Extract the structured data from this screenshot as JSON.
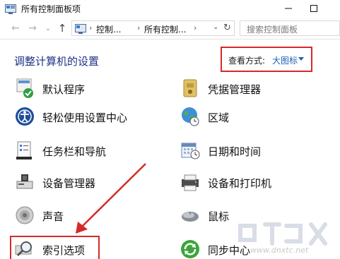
{
  "window": {
    "title": "所有控制面板项",
    "minimize_glyph": "—",
    "maximize_glyph": "☐"
  },
  "navigation": {
    "back_glyph": "←",
    "forward_glyph": "→",
    "recent_glyph": "⌄",
    "up_glyph": "↑",
    "breadcrumbs": [
      "控制...",
      "所有控制..."
    ],
    "separator": "›",
    "dropdown_glyph": "⌄",
    "refresh_glyph": "↻"
  },
  "search": {
    "placeholder": "搜索控制面板"
  },
  "header": {
    "heading": "调整计算机的设置",
    "view_by_label": "查看方式:",
    "view_by_value": "大图标"
  },
  "items": [
    {
      "label": "默认程序",
      "icon": "default-programs-icon"
    },
    {
      "label": "凭据管理器",
      "icon": "credential-manager-icon"
    },
    {
      "label": "轻松使用设置中心",
      "icon": "ease-of-access-icon"
    },
    {
      "label": "区域",
      "icon": "region-icon"
    },
    {
      "label": "任务栏和导航",
      "icon": "taskbar-icon"
    },
    {
      "label": "日期和时间",
      "icon": "date-time-icon"
    },
    {
      "label": "设备管理器",
      "icon": "device-manager-icon"
    },
    {
      "label": "设备和打印机",
      "icon": "devices-printers-icon"
    },
    {
      "label": "声音",
      "icon": "sound-icon"
    },
    {
      "label": "鼠标",
      "icon": "mouse-icon"
    },
    {
      "label": "索引选项",
      "icon": "indexing-options-icon"
    },
    {
      "label": "同步中心",
      "icon": "sync-center-icon"
    }
  ],
  "annotations": {
    "highlight_color": "#d42a2a"
  },
  "watermark": {
    "text": "www.dnxtc.net"
  }
}
